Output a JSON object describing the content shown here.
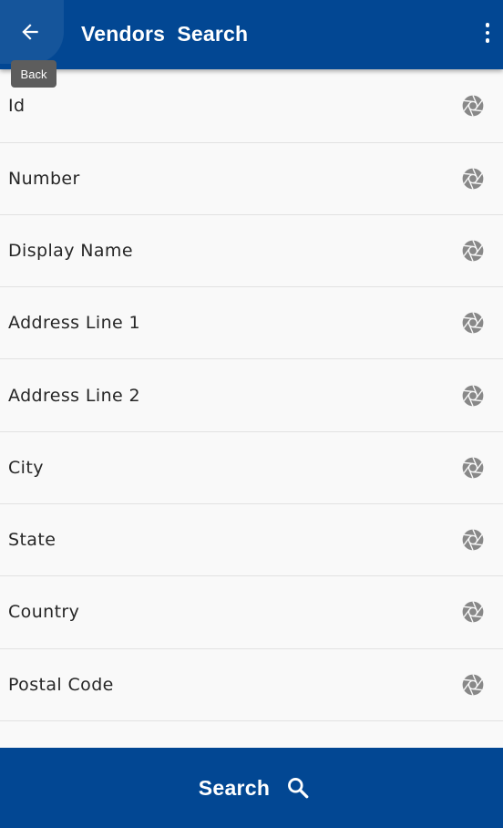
{
  "header": {
    "title": "Vendors  Search",
    "back_icon": "arrow-left-icon",
    "menu_icon": "more-vertical-icon",
    "back_tooltip": "Back",
    "color": "#024793"
  },
  "fields": [
    {
      "label": "Id",
      "icon": "aperture-icon"
    },
    {
      "label": "Number",
      "icon": "aperture-icon"
    },
    {
      "label": "Display Name",
      "icon": "aperture-icon"
    },
    {
      "label": "Address Line 1",
      "icon": "aperture-icon"
    },
    {
      "label": "Address Line 2",
      "icon": "aperture-icon"
    },
    {
      "label": "City",
      "icon": "aperture-icon"
    },
    {
      "label": "State",
      "icon": "aperture-icon"
    },
    {
      "label": "Country",
      "icon": "aperture-icon"
    },
    {
      "label": "Postal Code",
      "icon": "aperture-icon"
    }
  ],
  "footer": {
    "search_label": "Search",
    "search_icon": "magnifier-icon",
    "color": "#024793"
  }
}
